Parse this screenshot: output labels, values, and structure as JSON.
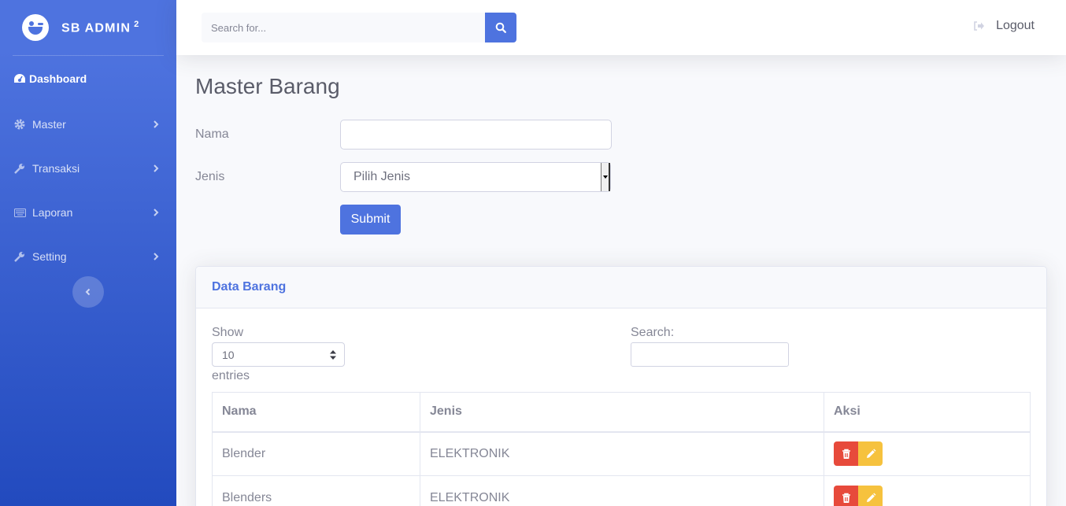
{
  "brand": {
    "name": "SB ADMIN",
    "sup": "2"
  },
  "sidebar": {
    "items": [
      {
        "label": "Dashboard",
        "icon": "dashboard-icon"
      },
      {
        "label": "Master",
        "icon": "gear-icon"
      },
      {
        "label": "Transaksi",
        "icon": "wrench-icon"
      },
      {
        "label": "Laporan",
        "icon": "keyboard-icon"
      },
      {
        "label": "Setting",
        "icon": "wrench-icon"
      }
    ],
    "toggle_icon": "chevron-left-icon"
  },
  "topbar": {
    "search_placeholder": "Search for...",
    "search_icon": "search-icon",
    "logout_label": "Logout",
    "logout_icon": "sign-out-icon"
  },
  "page": {
    "title": "Master Barang",
    "form": {
      "nama_label": "Nama",
      "nama_value": "",
      "jenis_label": "Jenis",
      "jenis_selected": "Pilih Jenis",
      "submit_label": "Submit"
    }
  },
  "card": {
    "title": "Data Barang",
    "show_label": "Show",
    "length_value": "10",
    "entries_label": "entries",
    "search_label": "Search:",
    "table": {
      "headers": [
        "Nama",
        "Jenis",
        "Aksi"
      ],
      "rows": [
        {
          "nama": "Blender",
          "jenis": "ELEKTRONIK"
        },
        {
          "nama": "Blenders",
          "jenis": "ELEKTRONIK"
        }
      ]
    }
  },
  "colors": {
    "primary": "#4e73df",
    "danger": "#e74a3b",
    "warning": "#f6c23e"
  }
}
